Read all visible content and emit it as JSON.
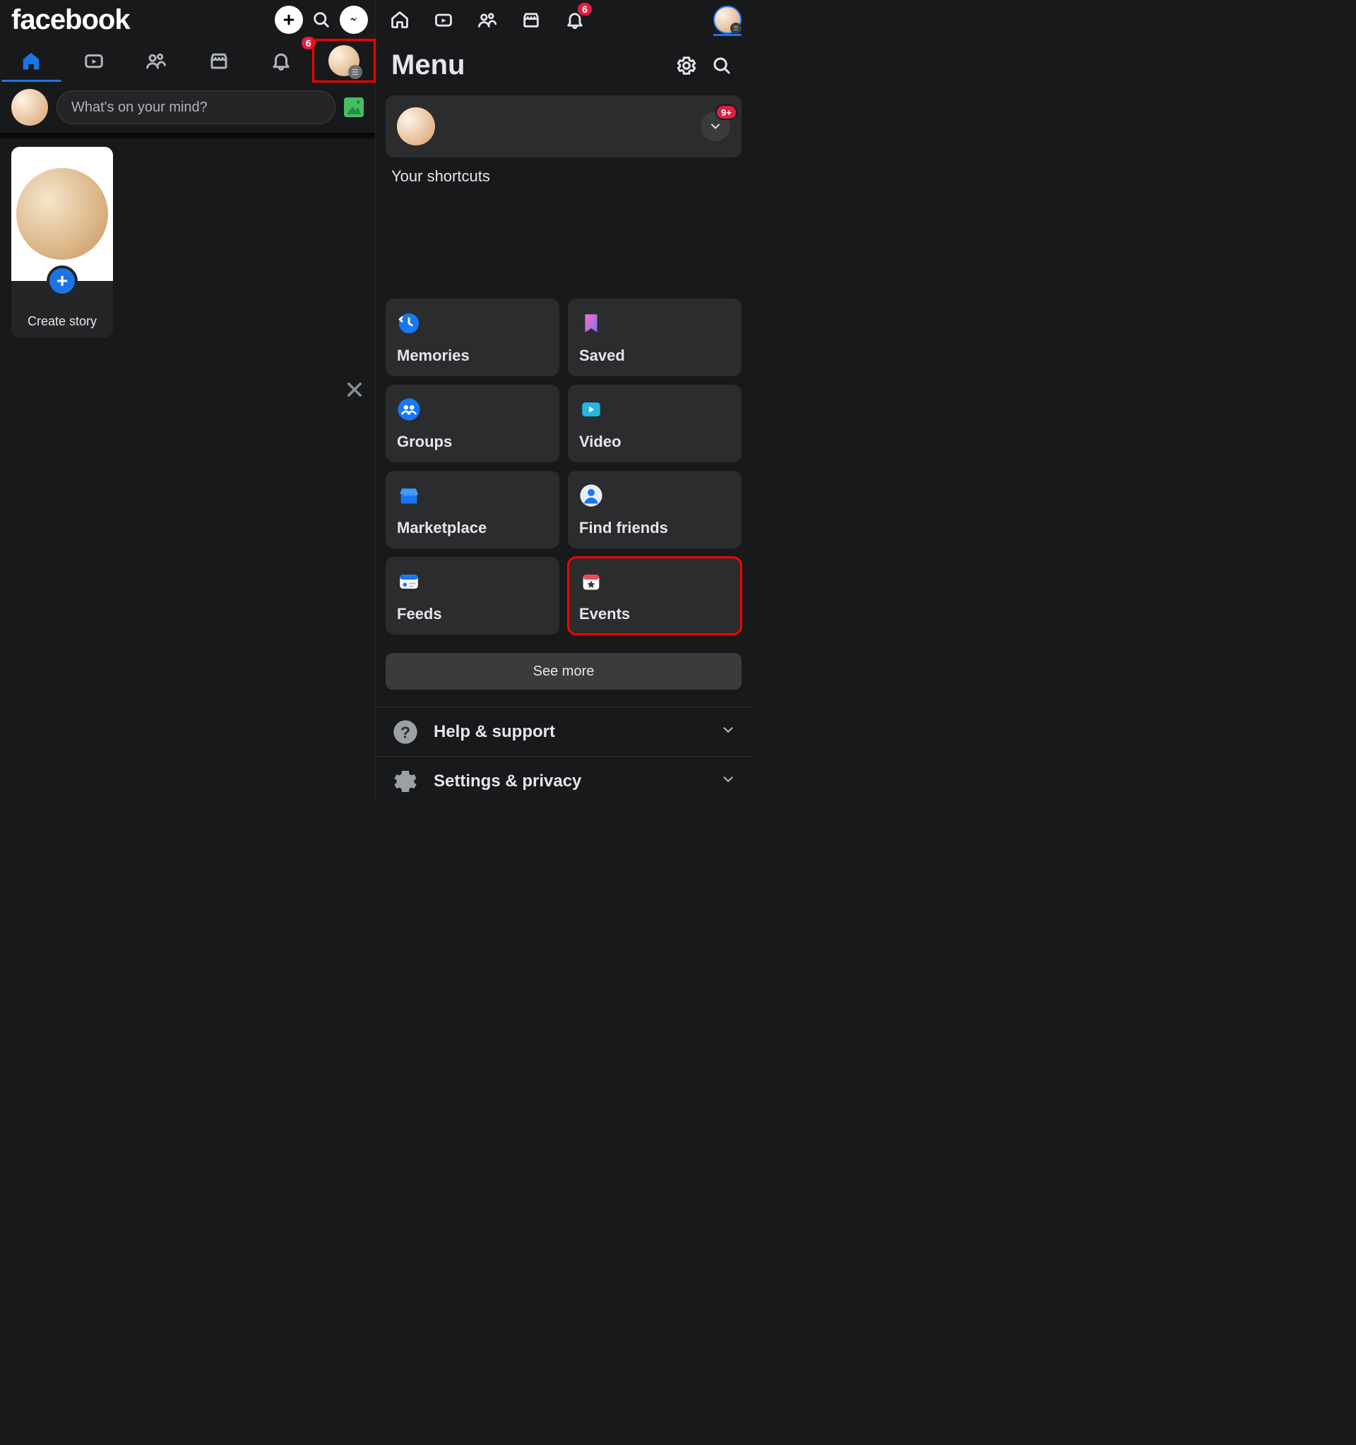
{
  "brand": "facebook",
  "left": {
    "tabs_badge": "6",
    "composer_placeholder": "What's on your mind?",
    "create_story": "Create story"
  },
  "right": {
    "header_badge": "6",
    "menu_title": "Menu",
    "profile_badge": "9+",
    "shortcuts_heading": "Your shortcuts",
    "menu_items": {
      "memories": "Memories",
      "saved": "Saved",
      "groups": "Groups",
      "video": "Video",
      "marketplace": "Marketplace",
      "find_friends": "Find friends",
      "feeds": "Feeds",
      "events": "Events"
    },
    "see_more": "See more",
    "help_support": "Help & support",
    "settings_privacy": "Settings & privacy"
  }
}
